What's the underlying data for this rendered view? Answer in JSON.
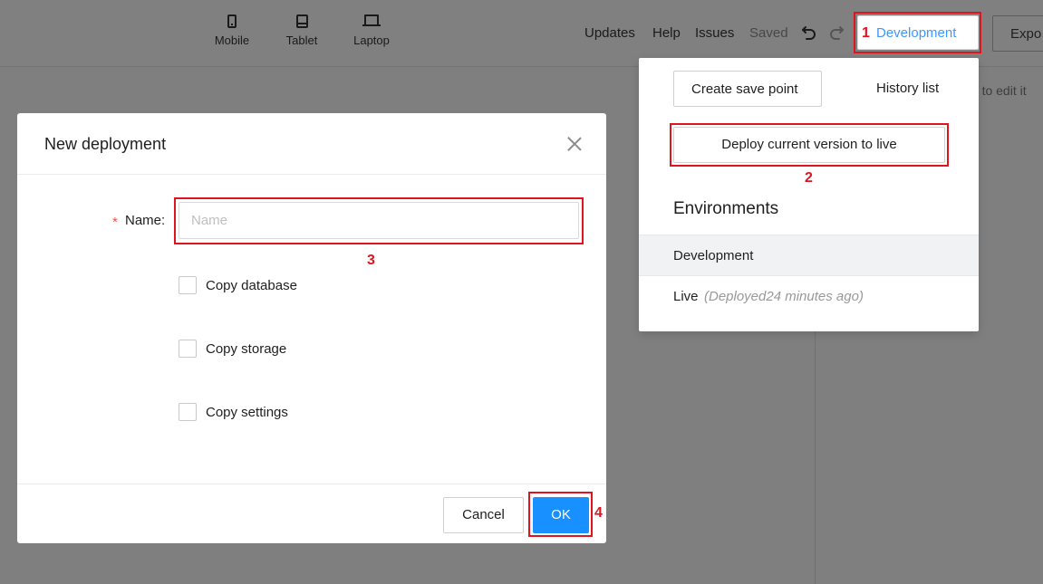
{
  "toolbar": {
    "devices": [
      "Mobile",
      "Tablet",
      "Laptop"
    ],
    "links": [
      "Updates",
      "Help",
      "Issues"
    ],
    "saved_status": "Saved",
    "env_button": "Development",
    "export_button": "Expo"
  },
  "canvas": {
    "hint_text": "nt to edit it"
  },
  "dropdown": {
    "create_save_point": "Create save point",
    "history_list": "History list",
    "deploy_button": "Deploy current version to live",
    "environments_heading": "Environments",
    "environments": [
      {
        "name": "Development",
        "meta": ""
      },
      {
        "name": "Live",
        "meta": "(Deployed24 minutes ago)"
      }
    ]
  },
  "modal": {
    "title": "New deployment",
    "required_marker": "*",
    "name_label": "Name",
    "name_placeholder": "Name",
    "name_value": "",
    "checkboxes": [
      "Copy database",
      "Copy storage",
      "Copy settings"
    ],
    "cancel_button": "Cancel",
    "ok_button": "OK"
  },
  "annotations": [
    "1",
    "2",
    "3",
    "4"
  ],
  "colors": {
    "overlay": "#7f7f7f",
    "primary": "#1890ff",
    "link_blue": "#4096ff",
    "annotation_red": "#e0141e",
    "required_red": "#ff4d4f"
  },
  "icons": [
    "mobile-icon",
    "tablet-icon",
    "laptop-icon",
    "undo-icon",
    "redo-icon",
    "close-icon"
  ]
}
